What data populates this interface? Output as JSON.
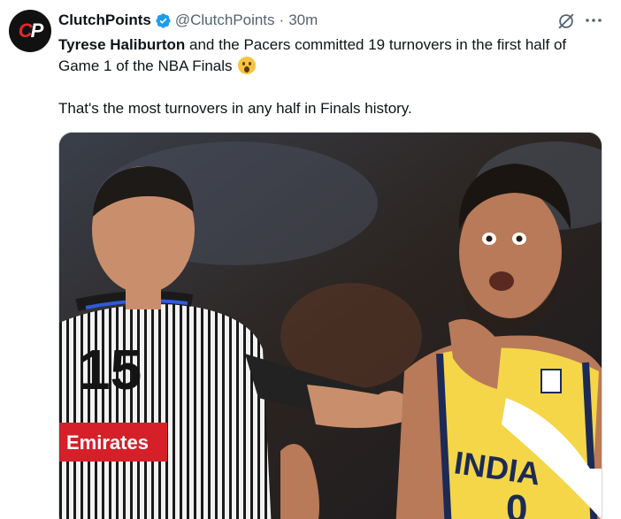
{
  "author": {
    "display_name": "ClutchPoints",
    "handle": "@ClutchPoints",
    "separator": "·",
    "time": "30m",
    "avatar_text_left": "C",
    "avatar_text_right": "P"
  },
  "tweet": {
    "mention": "Tyrese Haliburton",
    "line1_rest": " and the Pacers committed 19 turnovers in the first half of Game 1 of the NBA Finals ",
    "emoji_icon": "astonished-face-emoji",
    "line2": "That's the most turnovers in any half in Finals history."
  },
  "media": {
    "referee_number": "15",
    "referee_patch": "Emirates",
    "jersey_text": "INDIA",
    "jersey_number": "0"
  },
  "colors": {
    "accent": "#1d9bf0",
    "text": "#0f1419",
    "secondary": "#536471",
    "patch_red": "#d5202a",
    "jersey_yellow": "#f4d648"
  }
}
